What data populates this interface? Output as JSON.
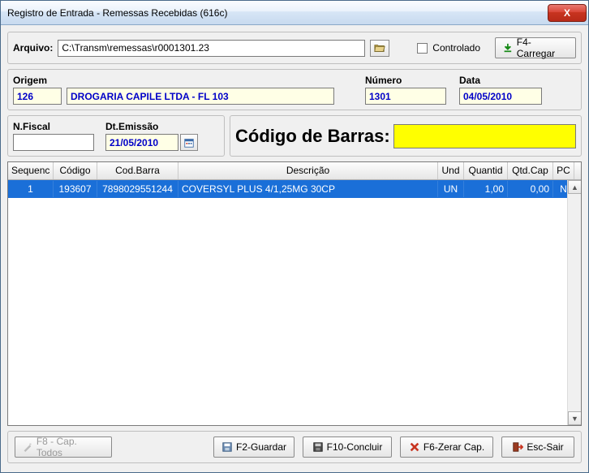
{
  "window": {
    "title": "Registro de Entrada - Remessas Recebidas (616c)",
    "close": "X"
  },
  "file": {
    "label": "Arquivo:",
    "path": "C:\\Transm\\remessas\\r0001301.23",
    "controlado_label": "Controlado",
    "carregar_label": "F4-Carregar"
  },
  "header": {
    "origem_label": "Origem",
    "origem_code": "126",
    "origem_name": "DROGARIA CAPILE LTDA - FL 103",
    "numero_label": "Número",
    "numero": "1301",
    "data_label": "Data",
    "data": "04/05/2010"
  },
  "nf": {
    "nf_label": "N.Fiscal",
    "nf_value": "",
    "emissao_label": "Dt.Emissão",
    "emissao": "21/05/2010",
    "barras_label": "Código de Barras:"
  },
  "table": {
    "headers": {
      "sequenc": "Sequenc",
      "codigo": "Código",
      "codbarra": "Cod.Barra",
      "descricao": "Descrição",
      "und": "Und",
      "quantid": "Quantid",
      "qtdcap": "Qtd.Cap",
      "pc": "PC"
    },
    "rows": [
      {
        "seq": "1",
        "codigo": "193607",
        "codbarra": "7898029551244",
        "desc": "COVERSYL PLUS 4/1,25MG 30CP",
        "und": "UN",
        "qtd": "1,00",
        "cap": "0,00",
        "pc": "N"
      }
    ]
  },
  "buttons": {
    "cap_todos": "F8 - Cap. Todos",
    "guardar": "F2-Guardar",
    "concluir": "F10-Concluir",
    "zerar": "F6-Zerar Cap.",
    "sair": "Esc-Sair"
  }
}
